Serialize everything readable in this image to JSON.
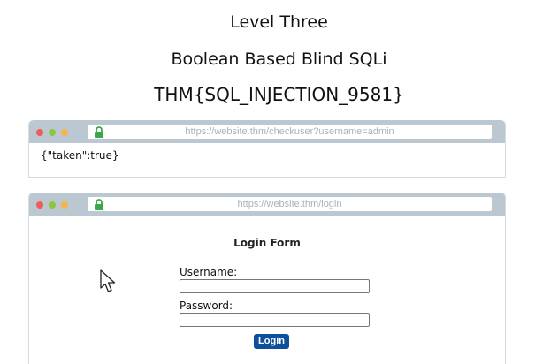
{
  "header": {
    "level_title": "Level Three",
    "level_subtitle": "Boolean Based Blind SQLi",
    "flag": "THM{SQL_INJECTION_9581}"
  },
  "checkuser_window": {
    "url": "https://website.thm/checkuser?username=admin",
    "response": "{\"taken\":true}"
  },
  "login_window": {
    "url": "https://website.thm/login",
    "form_title": "Login Form",
    "username_label": "Username:",
    "username_value": "",
    "password_label": "Password:",
    "password_value": "",
    "login_button_label": "Login"
  },
  "colors": {
    "browser_bar": "#bcc8d1",
    "login_button": "#0d4f9c",
    "lock_icon": "#3aa74a",
    "dot_red": "#f05d57",
    "dot_yellow": "#8cc63f",
    "dot_orange": "#f5b54a"
  },
  "icons": {
    "address_lock": "lock-icon",
    "pointer": "mouse-cursor-icon"
  }
}
